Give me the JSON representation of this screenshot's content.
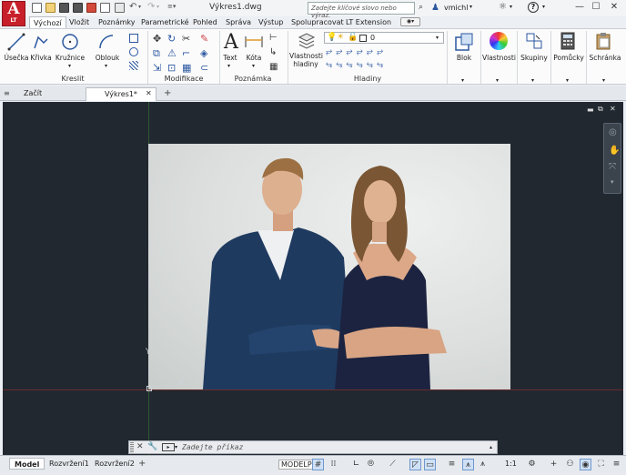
{
  "app": {
    "logo_letter": "A",
    "logo_sub": "LT"
  },
  "title": {
    "document": "Výkres1.dwg"
  },
  "search": {
    "placeholder": "Zadejte klíčové slovo nebo výraz."
  },
  "user": {
    "name": "vmichl"
  },
  "ribbon_tabs": [
    {
      "label": "Výchozí",
      "active": true
    },
    {
      "label": "Vložit"
    },
    {
      "label": "Poznámky"
    },
    {
      "label": "Parametrické"
    },
    {
      "label": "Pohled"
    },
    {
      "label": "Správa"
    },
    {
      "label": "Výstup"
    },
    {
      "label": "Spolupracovat"
    },
    {
      "label": "LT Extension"
    }
  ],
  "ribbon": {
    "draw": {
      "title": "Kreslit",
      "line": "Úsečka",
      "polyline": "Křivka",
      "circle": "Kružnice",
      "arc": "Oblouk"
    },
    "modify": {
      "title": "Modifikace"
    },
    "annotation": {
      "title": "Poznámka",
      "text": "Text",
      "dimension": "Kóta"
    },
    "layers": {
      "title": "Hladiny",
      "properties_l1": "Vlastnosti",
      "properties_l2": "hladiny",
      "current_layer": "0"
    },
    "block": "Blok",
    "properties": "Vlastnosti",
    "groups": "Skupiny",
    "utilities": "Pomůcky",
    "clipboard": "Schránka"
  },
  "doc_tabs": [
    {
      "label": "Začít"
    },
    {
      "label": "Výkres1*",
      "active": true
    }
  ],
  "command": {
    "placeholder": "Zadejte příkaz"
  },
  "layout_tabs": [
    {
      "label": "Model",
      "active": true
    },
    {
      "label": "Rozvržení1"
    },
    {
      "label": "Rozvržení2"
    }
  ],
  "status": {
    "model": "MODELP",
    "scale": "1:1"
  },
  "colors": {
    "canvas": "#212830",
    "accent": "#2b57a0",
    "app_red": "#c8202b"
  }
}
